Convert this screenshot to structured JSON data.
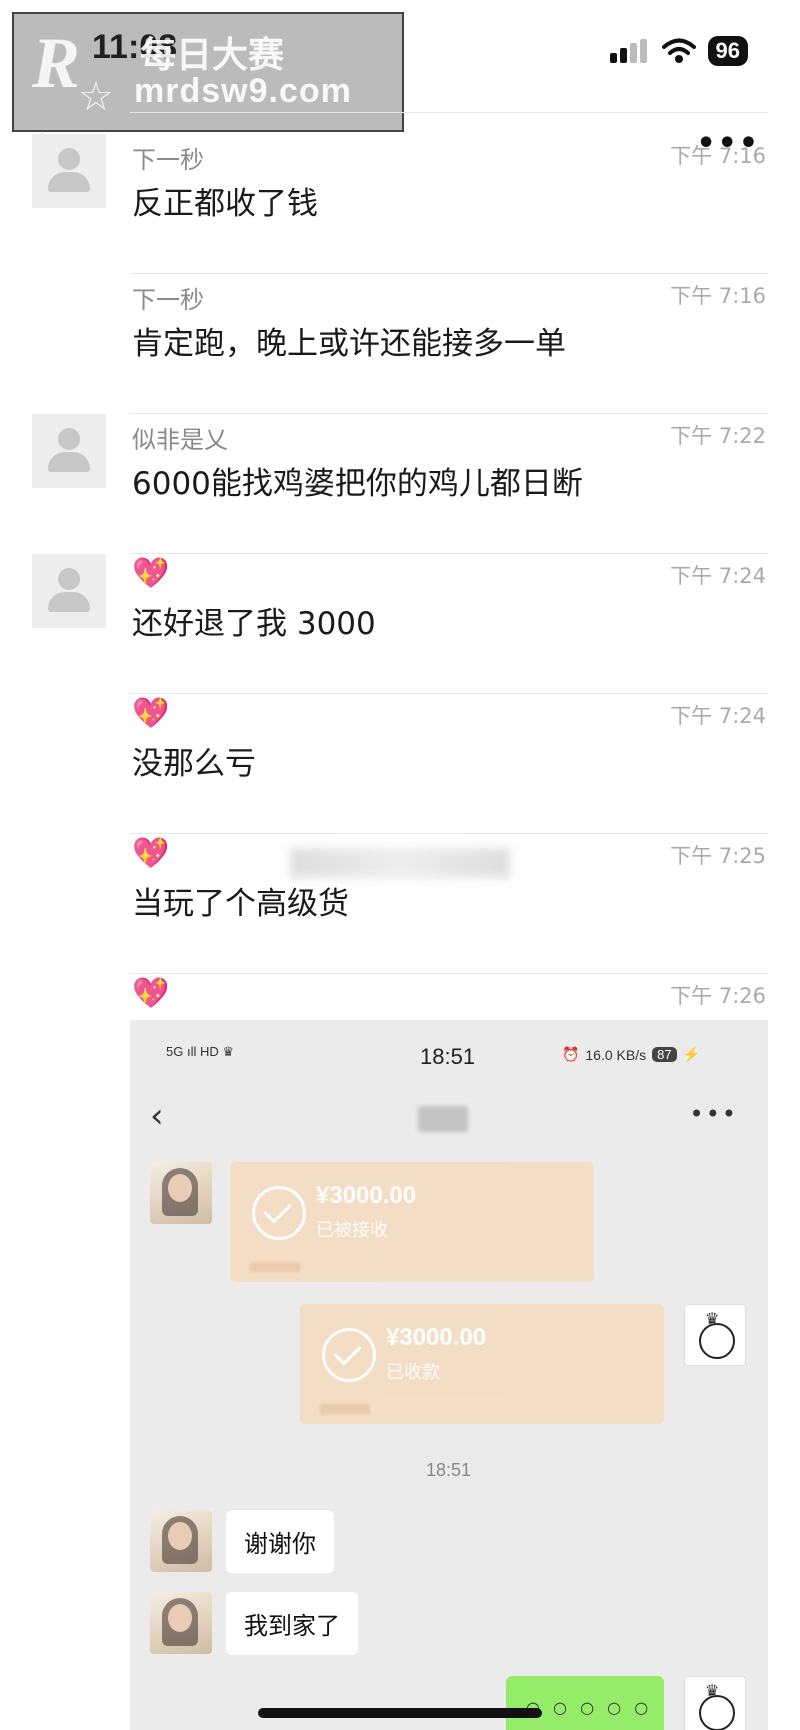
{
  "status_bar": {
    "time": "11:08",
    "battery": "96"
  },
  "watermark": {
    "logo": "R",
    "title": "每日大赛",
    "url": "mrdsw9.com"
  },
  "header": {
    "back_icon": "chevron-left-icon",
    "more_label": "•••"
  },
  "messages": [
    {
      "sender": "下一秒",
      "time": "下午 7:16",
      "text": "反正都收了钱",
      "avatar": true
    },
    {
      "sender": "下一秒",
      "time": "下午 7:16",
      "text": "肯定跑，晚上或许还能接多一单",
      "avatar": false
    },
    {
      "sender": "似非是乂",
      "time": "下午 7:22",
      "text": "6000能找鸡婆把你的鸡儿都日断",
      "avatar": true
    },
    {
      "sender_emoji": "💖",
      "time": "下午 7:24",
      "text": "还好退了我 3000",
      "avatar": true
    },
    {
      "sender_emoji": "💖",
      "time": "下午 7:24",
      "text": "没那么亏",
      "avatar": false
    },
    {
      "sender_emoji": "💖",
      "time": "下午 7:25",
      "text": "当玩了个高级货",
      "avatar": false
    },
    {
      "sender_emoji": "💖",
      "time": "下午 7:26",
      "text": "",
      "avatar": false
    }
  ],
  "screenshot": {
    "status_time": "18:51",
    "status_left": "5G ıll HD ♛",
    "status_speed": "16.0 KB/s",
    "status_battery": "87",
    "more_label": "•••",
    "transfers": [
      {
        "amount": "¥3000.00",
        "status": "已被接收"
      },
      {
        "amount": "¥3000.00",
        "status": "已收款"
      }
    ],
    "timestamp": "18:51",
    "bubbles": [
      "谢谢你",
      "我到家了"
    ],
    "green_bubble_dots": "○ ○ ○ ○ ○"
  }
}
